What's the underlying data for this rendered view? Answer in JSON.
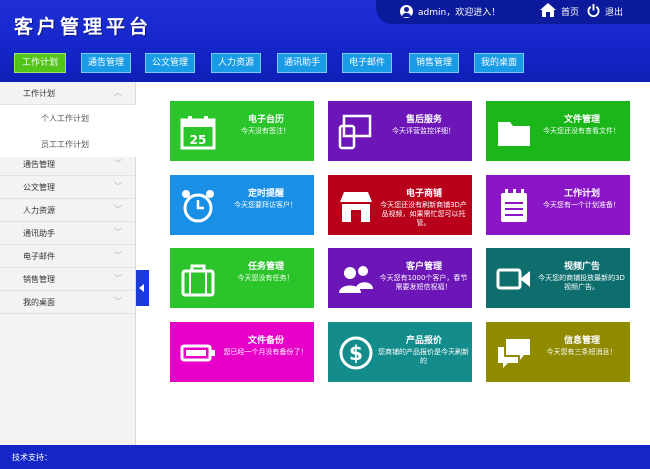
{
  "app": {
    "title": "客户管理平台"
  },
  "topbar": {
    "welcome": "admin，欢迎进入！",
    "home": "首页",
    "logout": "退出"
  },
  "nav": {
    "items": [
      "工作计划",
      "通告管理",
      "公文管理",
      "人力资源",
      "通讯助手",
      "电子邮件",
      "销售管理",
      "我的桌面"
    ],
    "active": "工作计划"
  },
  "sidebar": {
    "items": [
      {
        "label": "工作计划",
        "chevron": "︿"
      },
      {
        "label": "个人工作计划"
      },
      {
        "label": "员工工作计划"
      },
      {
        "label": "通告管理",
        "chevron": "﹀"
      },
      {
        "label": "公文管理",
        "chevron": "﹀"
      },
      {
        "label": "人力资源",
        "chevron": "﹀"
      },
      {
        "label": "通讯助手",
        "chevron": "﹀"
      },
      {
        "label": "电子邮件",
        "chevron": "﹀"
      },
      {
        "label": "销售管理",
        "chevron": "﹀"
      },
      {
        "label": "我的桌面",
        "chevron": "﹀"
      }
    ]
  },
  "tiles": [
    {
      "title": "电子台历",
      "desc": "今天没有签注！",
      "icon": "calendar-icon",
      "color": "#2bc52b",
      "extra": "25"
    },
    {
      "title": "售后服务",
      "desc": "今天评营监控详细！",
      "icon": "devices-icon",
      "color": "#6d16b8"
    },
    {
      "title": "文件管理",
      "desc": "今天您还没有查看文件！",
      "icon": "folder-icon",
      "color": "#1ab61a"
    },
    {
      "title": "定时提醒",
      "desc": "今天您要拜访客户！",
      "icon": "alarm-clock-icon",
      "color": "#1a8fe6"
    },
    {
      "title": "电子商铺",
      "desc": "今天您还没有刷新商铺3D产品视频，如果需忙您可以托管。",
      "icon": "shop-icon",
      "color": "#b8001a"
    },
    {
      "title": "工作计划",
      "desc": "今天您有一个计划准备！",
      "icon": "notepad-icon",
      "color": "#8a16c8"
    },
    {
      "title": "任务管理",
      "desc": "今天您没有任务！",
      "icon": "bag-icon",
      "color": "#2bc52b"
    },
    {
      "title": "客户管理",
      "desc": "今天您有1000个客户，春节需要发短信祝福！",
      "icon": "users-icon",
      "color": "#6d16b8"
    },
    {
      "title": "视频广告",
      "desc": "今天您的商铺投放最新的3D视频广告。",
      "icon": "video-camera-icon",
      "color": "#0e6e6e"
    },
    {
      "title": "文件备份",
      "desc": "您已经一个月没有备份了！",
      "icon": "battery-icon",
      "color": "#e600c8"
    },
    {
      "title": "产品报价",
      "desc": "您商铺的产品报价是今天刷新的",
      "icon": "dollar-icon",
      "color": "#148c8c"
    },
    {
      "title": "信息管理",
      "desc": "今天您有三条短消息！",
      "icon": "chat-icon",
      "color": "#8f8a00"
    }
  ],
  "footer": {
    "text": "技术支持："
  }
}
